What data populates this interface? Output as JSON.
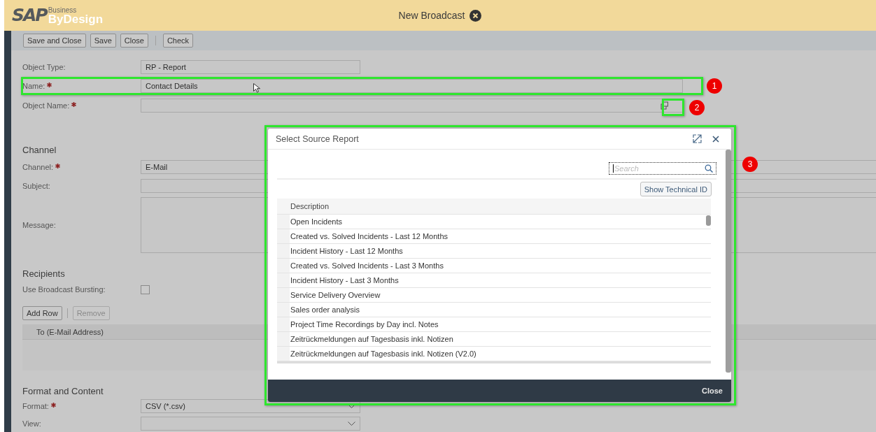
{
  "app": {
    "logo_brand": "SAP",
    "logo_super": "Business",
    "logo_product": "ByDesign",
    "title": "New Broadcast"
  },
  "toolbar": {
    "groups": [
      [
        "Save and Close",
        "Save",
        "Close"
      ],
      [
        "Check"
      ]
    ]
  },
  "sections": [
    {
      "fields": [
        {
          "label": "Object Type:",
          "required": false,
          "kind": "display",
          "value": "RP - Report"
        },
        {
          "label": "Name:",
          "required": true,
          "kind": "input",
          "value": "Contact Details"
        },
        {
          "label": "Object Name:",
          "required": true,
          "kind": "lookup"
        }
      ]
    },
    {
      "heading": "Channel",
      "fields": [
        {
          "label": "Channel:",
          "required": true,
          "kind": "input",
          "value": "E-Mail"
        },
        {
          "label": "Subject:",
          "required": false,
          "kind": "input"
        },
        {
          "label": "Message:",
          "required": false,
          "kind": "textarea"
        }
      ]
    },
    {
      "heading": "Recipients",
      "fields": [
        {
          "label": "Use Broadcast Bursting:",
          "required": false,
          "kind": "checkbox",
          "checked": false
        }
      ],
      "table": {
        "buttons": [
          {
            "label": "Add Row",
            "disabled": false
          },
          {
            "label": "Remove",
            "disabled": true
          }
        ],
        "columns": [
          "To (E-Mail Address)"
        ]
      }
    },
    {
      "heading": "Format and Content",
      "fields": [
        {
          "label": "Format:",
          "required": true,
          "kind": "dropdown",
          "value": "CSV (*.csv)"
        },
        {
          "label": "View:",
          "required": false,
          "kind": "dropdown"
        }
      ]
    }
  ],
  "dialog": {
    "title": "Select Source Report",
    "search": {
      "placeholder": "Search"
    },
    "toggle_button": "Show Technical ID",
    "column": "Description",
    "rows": [
      "Open Incidents",
      "Created vs. Solved Incidents - Last 12 Months",
      "Incident History - Last 12 Months",
      "Created vs. Solved Incidents - Last 3 Months",
      "Incident History - Last 3 Months",
      "Service Delivery Overview",
      "Sales order analysis",
      "Project Time Recordings by Day incl. Notes",
      "Zeitrückmeldungen auf Tagesbasis inkl. Notizen",
      "Zeitrückmeldungen auf Tagesbasis inkl. Notizen (V2.0)"
    ],
    "footer_button": "Close"
  },
  "annotations": [
    {
      "label": "1"
    },
    {
      "label": "2"
    },
    {
      "label": "3"
    }
  ]
}
